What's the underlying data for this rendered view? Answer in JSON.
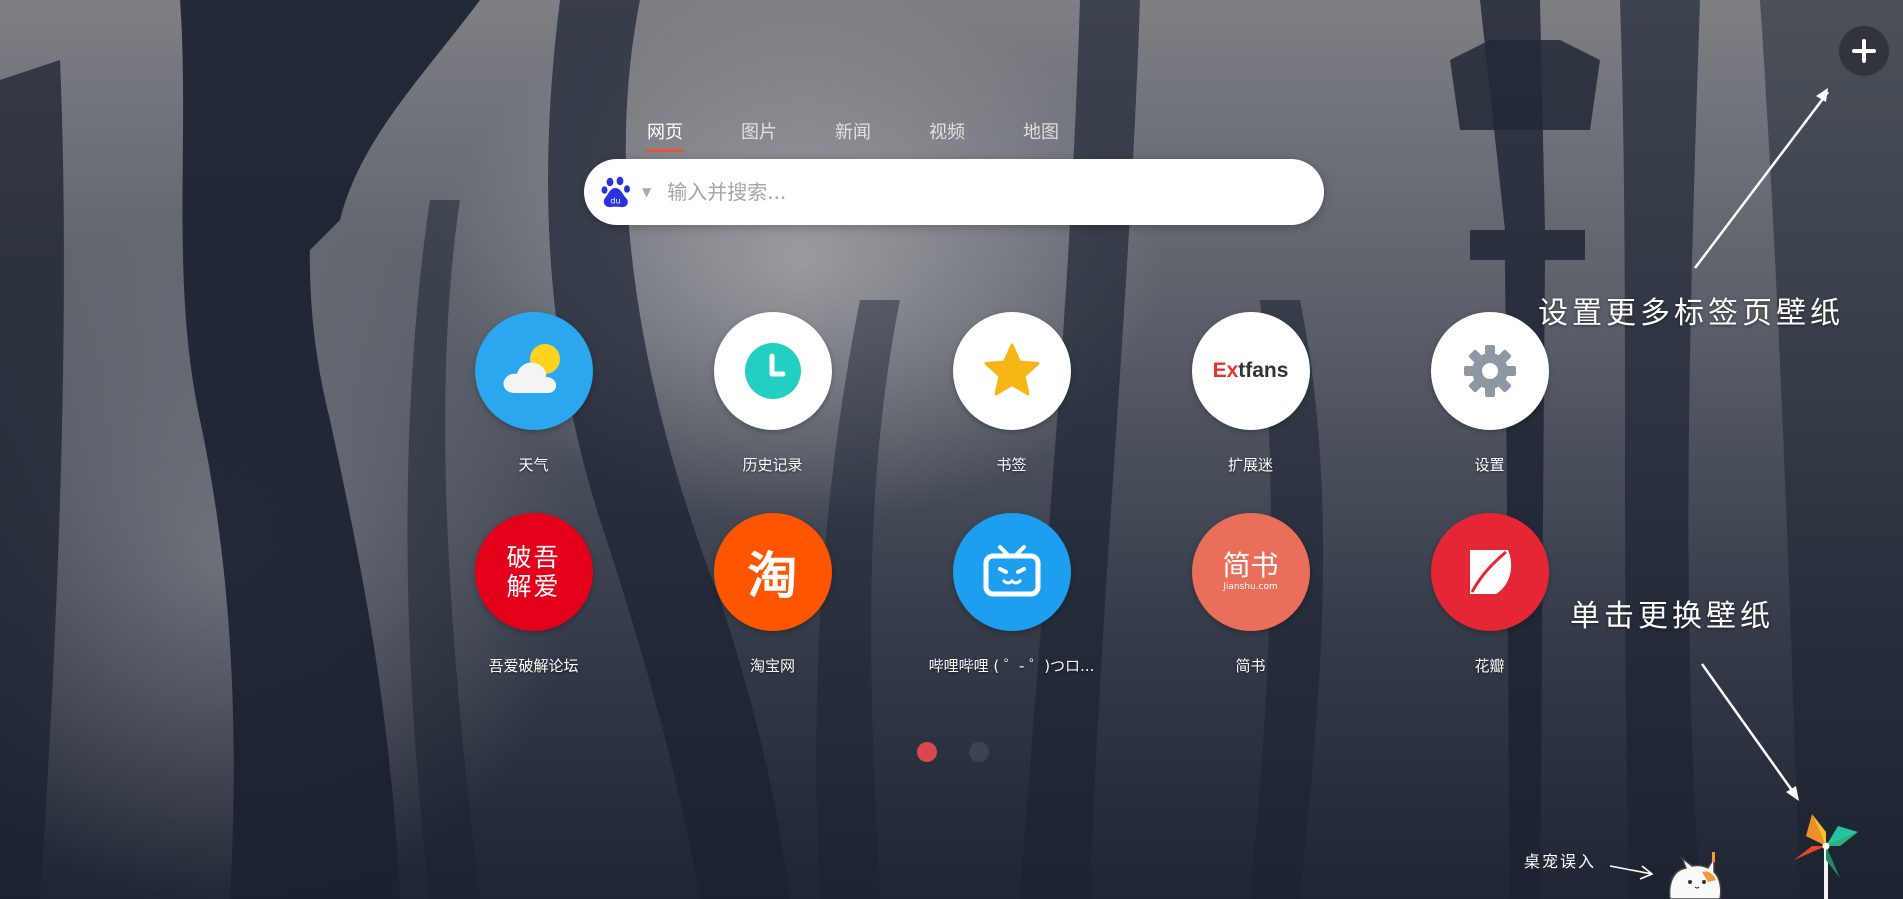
{
  "search": {
    "tabs": [
      {
        "label": "网页",
        "active": true
      },
      {
        "label": "图片",
        "active": false
      },
      {
        "label": "视频",
        "active": false
      },
      {
        "label": "新闻",
        "active": false
      },
      {
        "label": "地图",
        "active": false
      }
    ],
    "engine_icon": "baidu-paw-icon",
    "placeholder": "输入并搜索..."
  },
  "shortcuts": [
    {
      "label": "天气",
      "icon": "weather-icon",
      "bg": "#2aa7ef"
    },
    {
      "label": "历史记录",
      "icon": "clock-icon",
      "bg": "#ffffff"
    },
    {
      "label": "书签",
      "icon": "star-icon",
      "bg": "#ffffff"
    },
    {
      "label": "扩展迷",
      "icon": "extfans-logo-icon",
      "bg": "#ffffff",
      "logo_text_a": "Ex",
      "logo_text_b": "tfans"
    },
    {
      "label": "设置",
      "icon": "gear-icon",
      "bg": "#ffffff"
    },
    {
      "label": "吾爱破解论坛",
      "icon": "52pojie-logo-icon",
      "bg": "#e4001b",
      "logo_text_1": "破吾",
      "logo_text_2": "解爱"
    },
    {
      "label": "淘宝网",
      "icon": "taobao-logo-icon",
      "bg": "#ff5500",
      "logo_text": "淘"
    },
    {
      "label": "哔哩哔哩 ( ゜- ゜)つロ...",
      "icon": "bilibili-tv-icon",
      "bg": "#1e9eef"
    },
    {
      "label": "简书",
      "icon": "jianshu-logo-icon",
      "bg": "#ea6f5a",
      "logo_text": "简书",
      "logo_sub": "Jianshu.com"
    },
    {
      "label": "花瓣",
      "icon": "huaban-logo-icon",
      "bg": "#e52735"
    }
  ],
  "pagination": {
    "pages": 2,
    "current": 1,
    "active_color": "#d9464f",
    "inactive_color": "#3b4453"
  },
  "hints": {
    "add_wallpaper": "设置更多标签页壁纸",
    "change_wallpaper": "单击更换壁纸",
    "pet": "桌宠误入"
  },
  "controls": {
    "add_icon": "plus-icon",
    "pinwheel_icon": "pinwheel-icon",
    "pet_icon": "cat-pet-icon"
  }
}
